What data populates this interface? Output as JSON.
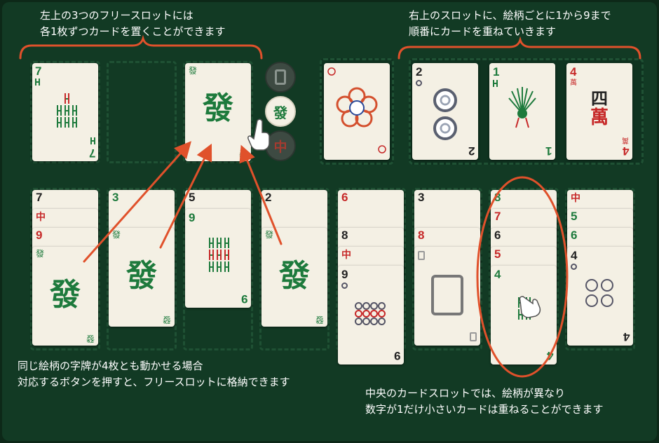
{
  "annotations": {
    "free_slots_line1": "左上の3つのフリースロットには",
    "free_slots_line2": "各1枚ずつカードを置くことができます",
    "foundation_line1": "右上のスロットに、絵柄ごとに1から9まで",
    "foundation_line2": "順番にカードを重ねていきます",
    "dragon_line1": "同じ絵柄の字牌が4枚とも動かせる場合",
    "dragon_line2": "対応するボタンを押すと、フリースロットに格納できます",
    "tableau_line1": "中央のカードスロットでは、絵柄が異なり",
    "tableau_line2": "数字が1だけ小さいカードは重ねることができます"
  },
  "symbols": {
    "green_dragon": "發",
    "red_dragon": "中",
    "wan": "萬",
    "four_kanji": "四"
  },
  "free_slots": [
    {
      "rank": "7",
      "suit": "bamboo"
    },
    {
      "empty": true
    },
    {
      "suit": "green-dragon"
    }
  ],
  "dragon_buttons": [
    {
      "name": "white-dragon",
      "state": "inactive"
    },
    {
      "name": "green-dragon",
      "state": "active"
    },
    {
      "name": "red-dragon",
      "state": "inactive"
    }
  ],
  "flower_slot": {
    "card": "flower"
  },
  "foundations": [
    {
      "rank": "2",
      "suit": "dots"
    },
    {
      "rank": "1",
      "suit": "bamboo"
    },
    {
      "rank": "4",
      "suit": "characters"
    }
  ],
  "tableau": [
    {
      "cards": [
        "7",
        "中",
        "9",
        "發"
      ]
    },
    {
      "cards": [
        "3",
        "發"
      ]
    },
    {
      "cards": [
        "5",
        "9"
      ]
    },
    {
      "cards": [
        "2",
        "發"
      ]
    },
    {
      "cards": [
        "6",
        "8",
        "中",
        "9"
      ]
    },
    {
      "cards": [
        "3",
        "8",
        "white-dragon"
      ]
    },
    {
      "cards": [
        "8",
        "7",
        "6",
        "5",
        "4"
      ]
    },
    {
      "cards": [
        "中",
        "5",
        "6",
        "4"
      ]
    }
  ],
  "colors": {
    "felt": "#123a24",
    "annotation": "#e0512b",
    "green": "#1d7a3c",
    "red": "#c62828"
  }
}
